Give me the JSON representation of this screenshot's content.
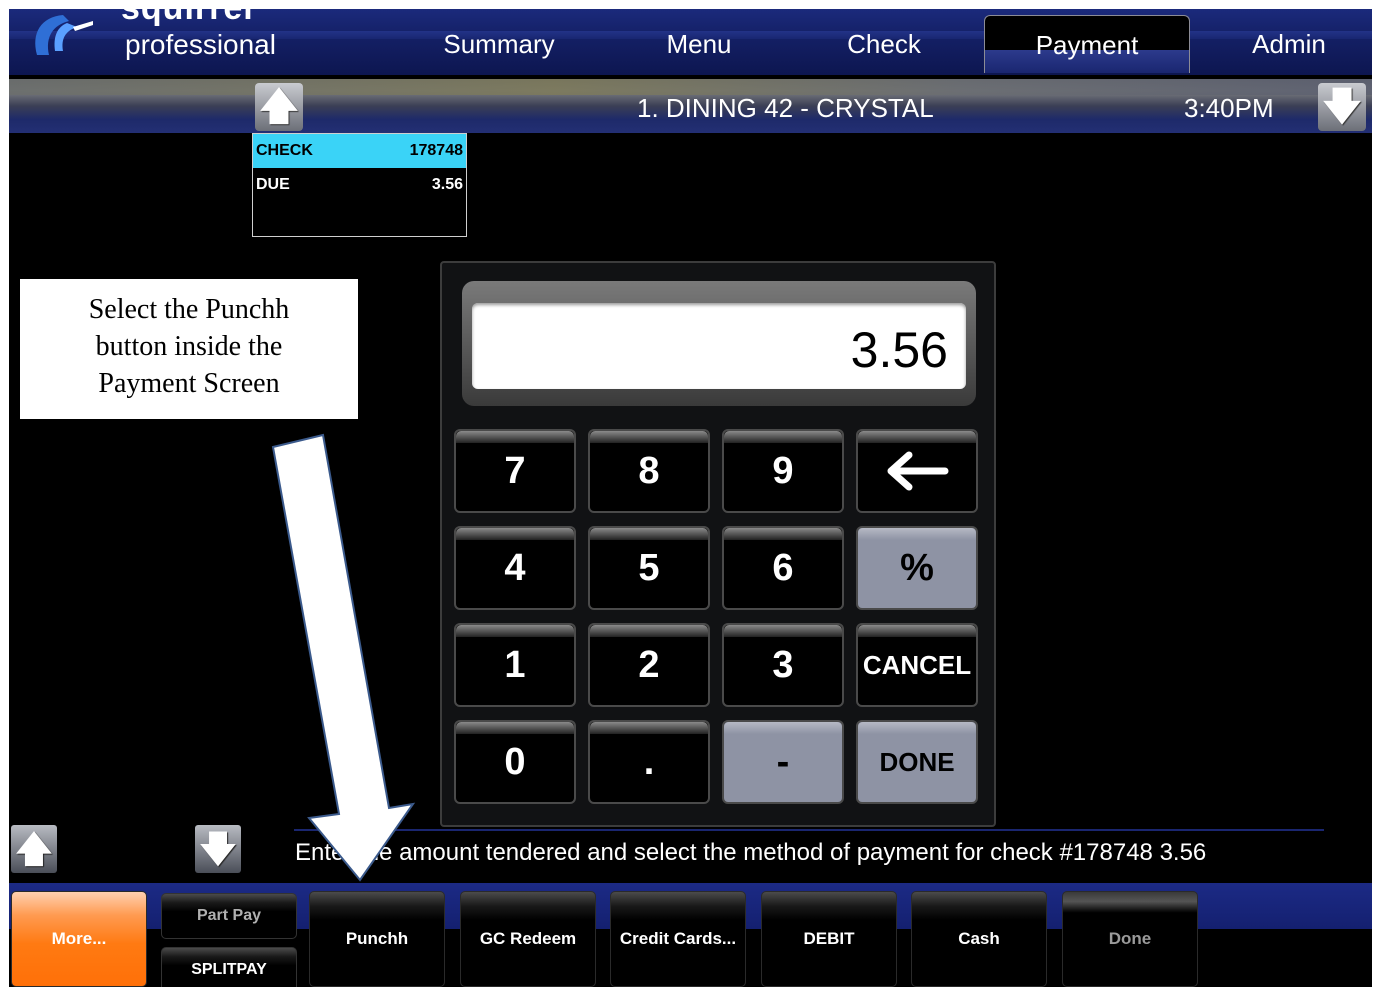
{
  "app": {
    "logo_top": "squirrel",
    "logo_text": "professional"
  },
  "nav": {
    "tabs": [
      "Summary",
      "Menu",
      "Check",
      "Payment",
      "Admin"
    ],
    "active": "Payment"
  },
  "header": {
    "title": "1. DINING 42 - CRYSTAL",
    "time": "3:40PM"
  },
  "check": {
    "label": "CHECK",
    "number": "178748",
    "due_label": "DUE",
    "due_amount": "3.56"
  },
  "callout": {
    "line1": "Select the Punchh",
    "line2": "button inside the",
    "line3": "Payment Screen"
  },
  "keypad": {
    "display": "3.56",
    "keys": [
      "7",
      "8",
      "9",
      "←",
      "4",
      "5",
      "6",
      "%",
      "1",
      "2",
      "3",
      "CANCEL",
      "0",
      ".",
      "-",
      "DONE"
    ]
  },
  "prompt": "Enter the amount tendered and select the method of payment for check #178748 3.56",
  "footer": {
    "more": "More...",
    "part_pay": "Part Pay",
    "splitpay": "SPLITPAY",
    "punchh": "Punchh",
    "gc_redeem": "GC Redeem",
    "credit_cards": "Credit Cards...",
    "debit": "DEBIT",
    "cash": "Cash",
    "done": "Done"
  },
  "colors": {
    "nav_blue": "#142066",
    "check_highlight": "#3ad3f7",
    "more_orange": "#ff7a12",
    "key_gray": "#8e93a4"
  }
}
